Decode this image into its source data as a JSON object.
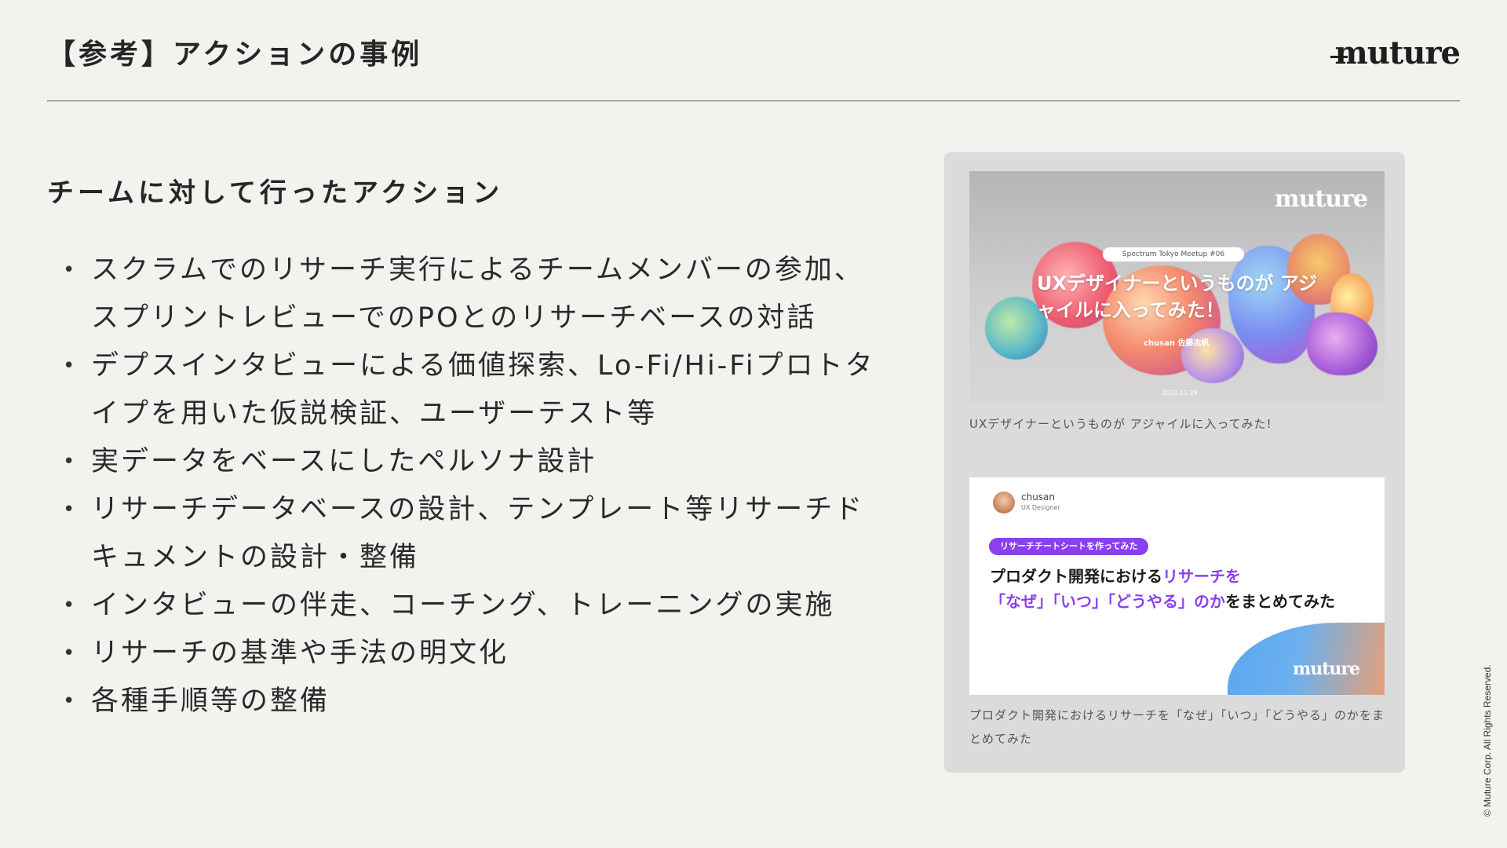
{
  "header": {
    "title": "【参考】アクションの事例",
    "logo": "muture"
  },
  "section": {
    "heading": "チームに対して行ったアクション"
  },
  "bullets": [
    "スクラムでのリサーチ実行によるチームメンバーの参加、スプリントレビューでのPOとのリサーチベースの対話",
    "デプスインタビューによる価値探索、Lo-Fi/Hi-Fiプロトタイプを用いた仮説検証、ユーザーテスト等",
    "実データをベースにしたペルソナ設計",
    "リサーチデータベースの設計、テンプレート等リサーチドキュメントの設計・整備",
    "インタビューの伴走、コーチング、トレーニングの実施",
    "リサーチの基準や手法の明文化",
    "各種手順等の整備"
  ],
  "cards": [
    {
      "thumb": {
        "logo": "muture",
        "event": "Spectrum Tokyo Meetup #06",
        "title": "UXデザイナーというものが アジャイルに入ってみた！",
        "author": "chusan 佐藤志帆",
        "date": "2023.11.29"
      },
      "caption": "UXデザイナーというものが アジャイルに入ってみた!"
    },
    {
      "thumb": {
        "author_name": "chusan",
        "author_role": "UX Designer",
        "tag": "リサーチチートシートを作ってみた",
        "headline_part1": "プロダクト開発における",
        "headline_accent1": "リサーチを",
        "headline_accent2": "「なぜ」「いつ」「どうやる」のか",
        "headline_part2": "をまとめてみた",
        "logo": "muture"
      },
      "caption": "プロダクト開発におけるリサーチを「なぜ」「いつ」「どうやる」のかをまとめてみた"
    }
  ],
  "footer": {
    "copyright": "© Muture Corp. All Rights Reserved."
  }
}
